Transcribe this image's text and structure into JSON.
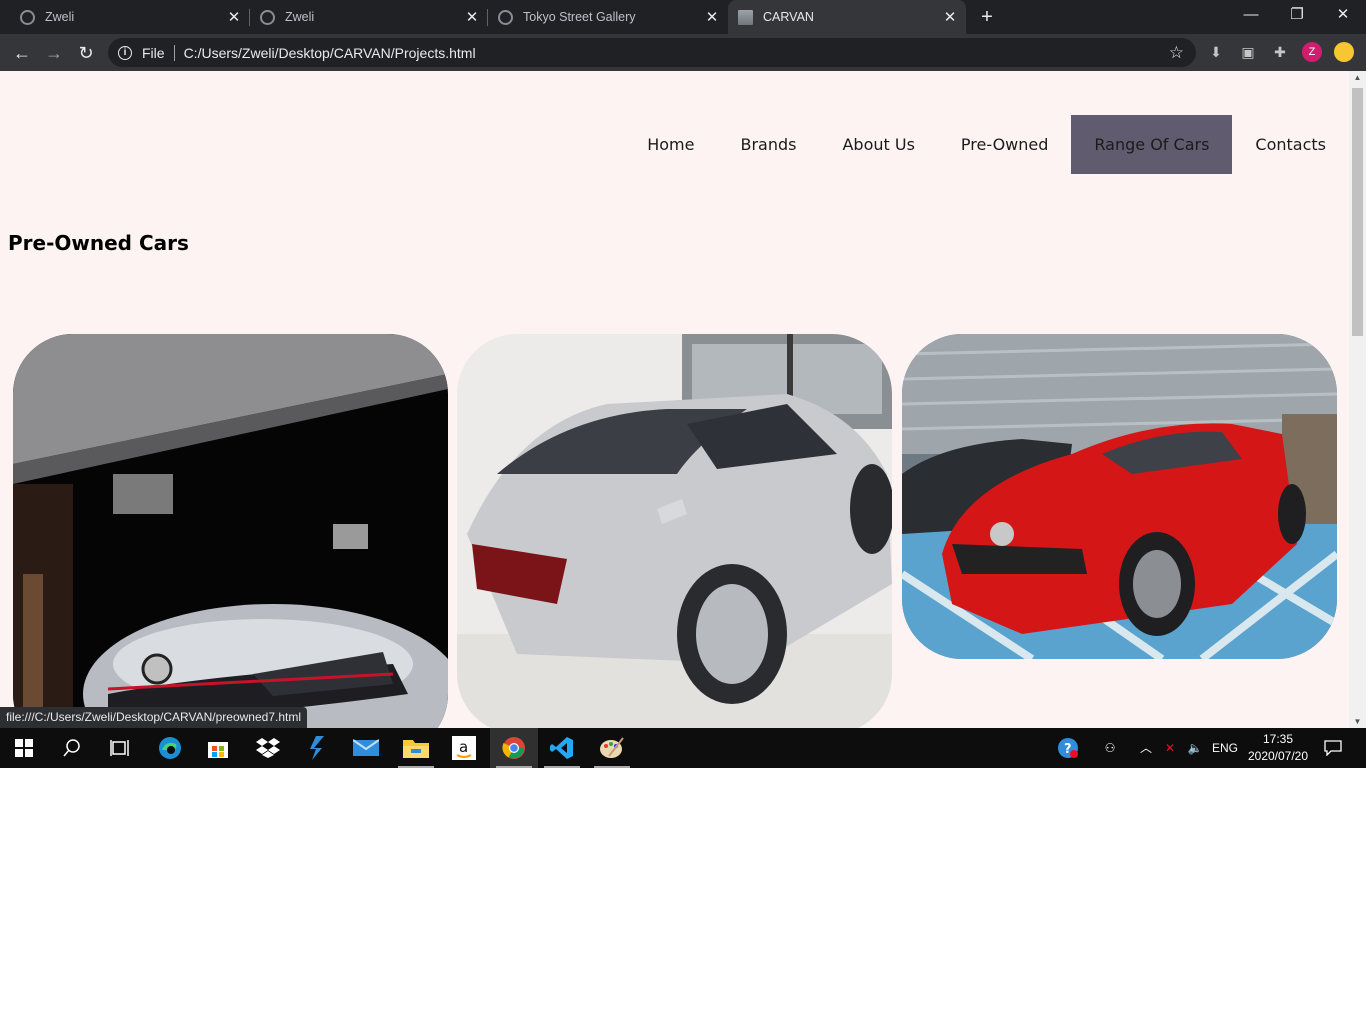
{
  "browser": {
    "tabs": [
      {
        "title": "Zweli",
        "active": false
      },
      {
        "title": "Zweli",
        "active": false
      },
      {
        "title": "Tokyo Street Gallery",
        "active": false
      },
      {
        "title": "CARVAN",
        "active": true
      }
    ],
    "new_tab_label": "+",
    "window_controls": {
      "minimize": "—",
      "restore": "❐",
      "close": "✕"
    },
    "address": {
      "scheme_label": "File",
      "url": "C:/Users/Zweli/Desktop/CARVAN/Projects.html"
    },
    "profile_initial": "Z",
    "status_url": "file:///C:/Users/Zweli/Desktop/CARVAN/preowned7.html"
  },
  "page": {
    "nav": [
      {
        "label": "Home",
        "active": false
      },
      {
        "label": "Brands",
        "active": false
      },
      {
        "label": "About Us",
        "active": false
      },
      {
        "label": "Pre-Owned",
        "active": false
      },
      {
        "label": "Range Of Cars",
        "active": true
      },
      {
        "label": "Contacts",
        "active": false
      }
    ],
    "heading": "Pre-Owned Cars",
    "cars": [
      {
        "icon": "white-hatchback-in-garage-photo"
      },
      {
        "icon": "silver-sedan-in-showroom-photo"
      },
      {
        "icon": "red-hatchback-in-parking-lot-photo"
      }
    ],
    "colors": {
      "page_bg": "#fdf3f3",
      "nav_active_bg": "#615b70"
    }
  },
  "taskbar": {
    "apps": [
      "windows-start",
      "search",
      "task-view",
      "edge",
      "microsoft-store",
      "dropbox",
      "azure-devops",
      "mail",
      "file-explorer",
      "amazon",
      "chrome",
      "vscode",
      "paint"
    ],
    "tray": {
      "language": "ENG",
      "time": "17:35",
      "date": "2020/07/20"
    }
  }
}
